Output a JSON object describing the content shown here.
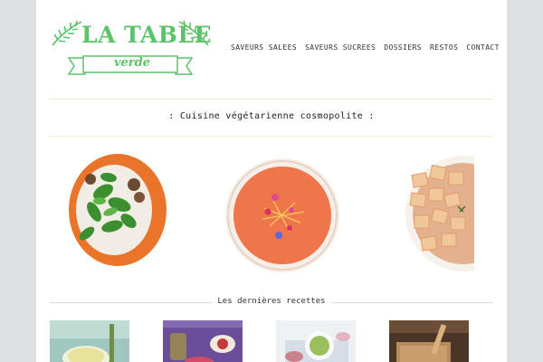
{
  "logo": {
    "title": "LA TABLE",
    "subtitle": "verde"
  },
  "nav": {
    "items": [
      "SAVEURS SALEES",
      "SAVEURS SUCREES",
      "DOSSIERS",
      "RESTOS",
      "CONTACT"
    ]
  },
  "tagline": ": Cuisine végétarienne cosmopolite :",
  "section": {
    "latest_title": "Les dernières recettes"
  },
  "colors": {
    "brand_green": "#5cc26b",
    "rule_yellow": "#e8f0c8",
    "side_bg": "#dde1e3"
  },
  "hero_images": [
    "salad-plate",
    "tomato-soup-bowl",
    "tofu-curry-bowl"
  ],
  "recipe_thumbs": [
    "lemon-drink",
    "purple-table-dish",
    "green-soup",
    "wooden-board"
  ]
}
